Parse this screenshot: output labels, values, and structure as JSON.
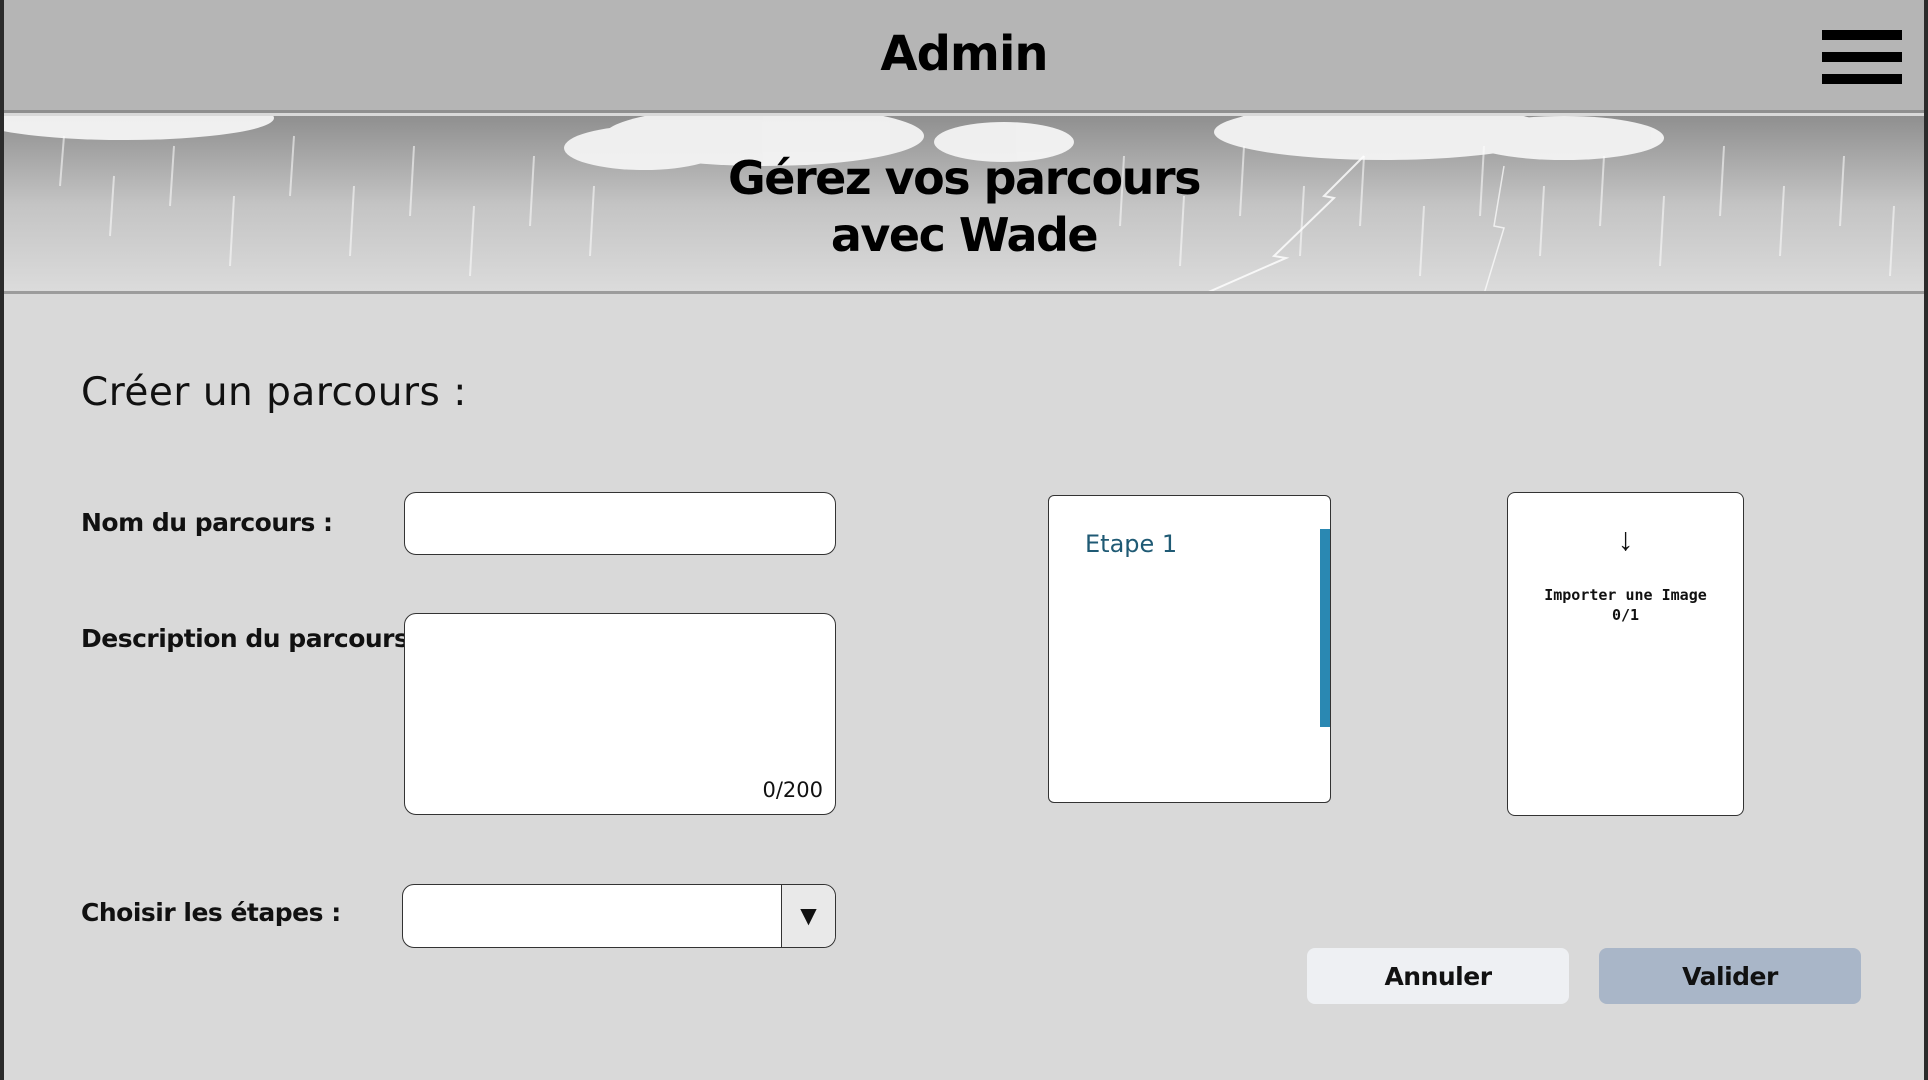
{
  "header": {
    "title": "Admin",
    "menu_icon": "hamburger-menu-icon"
  },
  "banner": {
    "line1": "Gérez vos parcours",
    "line2": "avec Wade"
  },
  "form": {
    "section_title": "Créer un parcours :",
    "name_label": "Nom du parcours :",
    "name_value": "",
    "description_label": "Description du parcours :",
    "description_value": "",
    "description_counter": "0/200",
    "steps_label": "Choisir les étapes :",
    "steps_selected": "",
    "steps_arrow": "▼"
  },
  "steps_list": {
    "items": [
      "Etape 1"
    ]
  },
  "import": {
    "icon": "↓",
    "label": "Importer une Image",
    "count": "0/1"
  },
  "actions": {
    "cancel": "Annuler",
    "validate": "Valider"
  },
  "colors": {
    "header_bg": "#b5b5b5",
    "page_bg": "#d9d9d9",
    "accent_scrollbar": "#2a88b2",
    "validate_bg": "#a9b6c8",
    "cancel_bg": "#eef0f3"
  }
}
